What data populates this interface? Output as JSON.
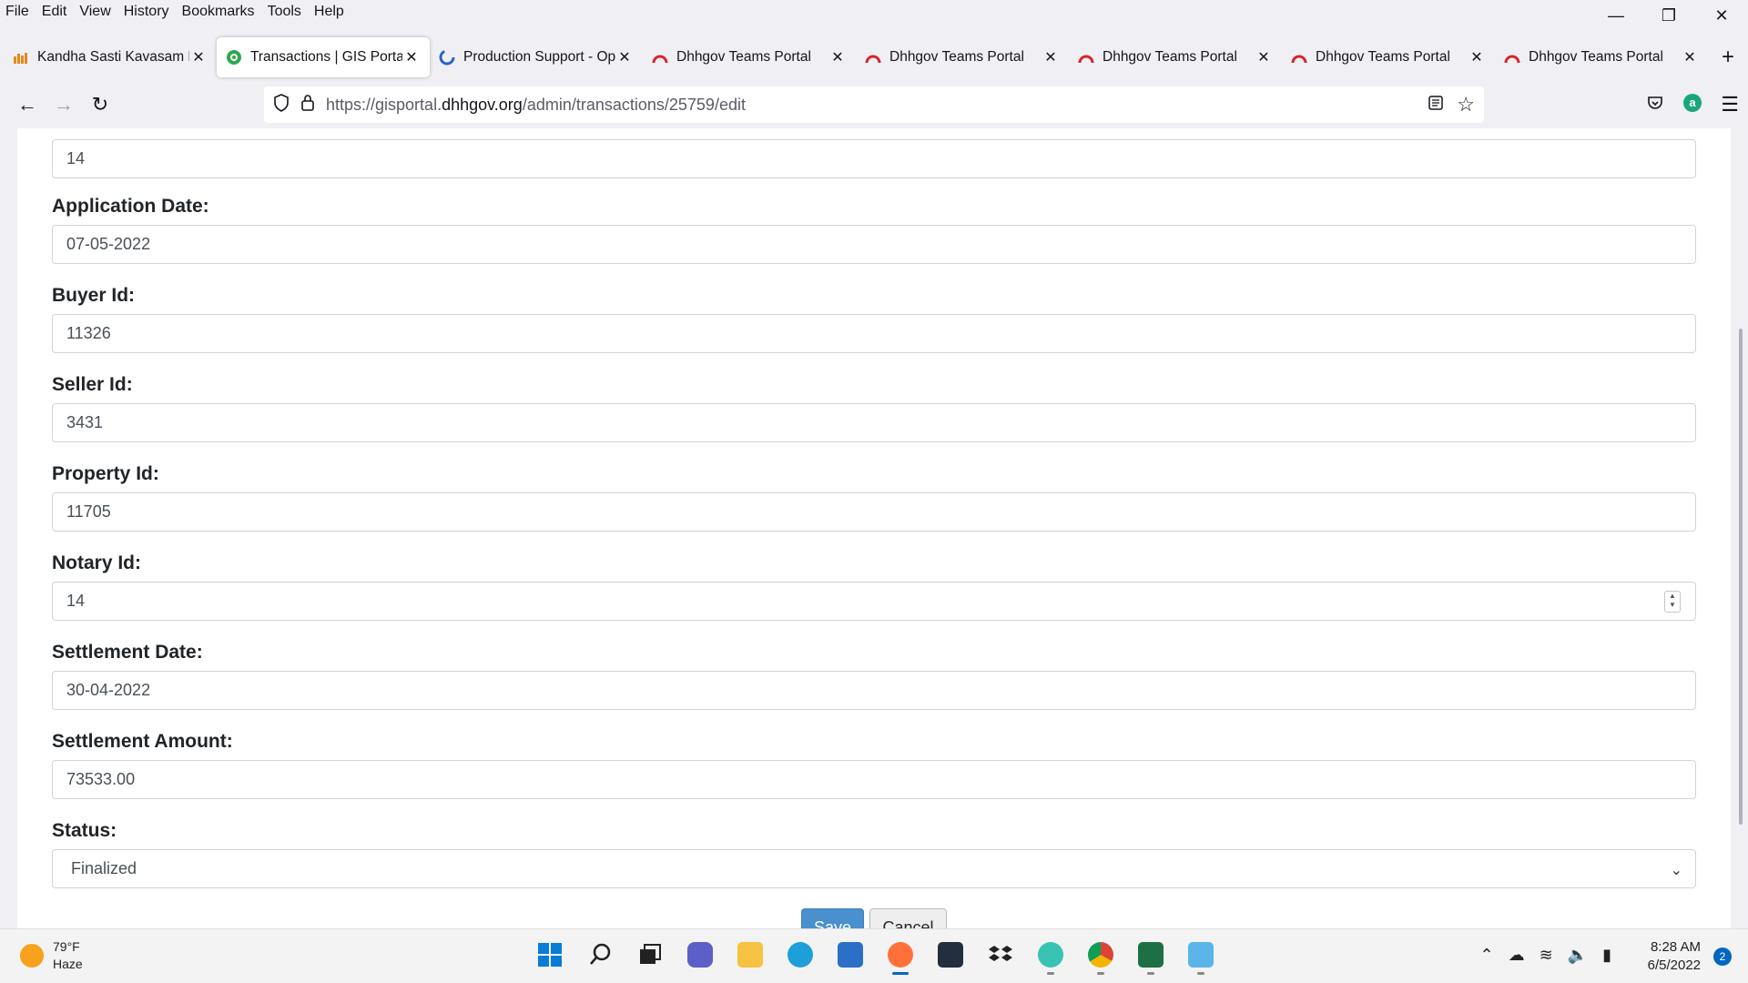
{
  "menubar": {
    "items": [
      "File",
      "Edit",
      "View",
      "History",
      "Bookmarks",
      "Tools",
      "Help"
    ]
  },
  "tabs": [
    {
      "title": "Kandha Sasti Kavasam Ly",
      "icon": "music-icon",
      "active": false
    },
    {
      "title": "Transactions | GIS Portal",
      "icon": "globe-icon",
      "active": true
    },
    {
      "title": "Production Support - Op",
      "icon": "loading-icon",
      "active": false
    },
    {
      "title": "Dhhgov Teams Portal",
      "icon": "teams-logo-icon",
      "active": false
    },
    {
      "title": "Dhhgov Teams Portal",
      "icon": "teams-logo-icon",
      "active": false
    },
    {
      "title": "Dhhgov Teams Portal",
      "icon": "teams-logo-icon",
      "active": false
    },
    {
      "title": "Dhhgov Teams Portal",
      "icon": "teams-logo-icon",
      "active": false
    },
    {
      "title": "Dhhgov Teams Portal",
      "icon": "teams-logo-icon",
      "active": false
    }
  ],
  "urlbar": {
    "prefix": "https://gisportal.",
    "domain": "dhhgov.org",
    "path": "/admin/transactions/25759/edit"
  },
  "form": {
    "top_field_value": "14",
    "application_date": {
      "label": "Application Date:",
      "value": "07-05-2022"
    },
    "buyer_id": {
      "label": "Buyer Id:",
      "value": "11326"
    },
    "seller_id": {
      "label": "Seller Id:",
      "value": "3431"
    },
    "property_id": {
      "label": "Property Id:",
      "value": "11705"
    },
    "notary_id": {
      "label": "Notary Id:",
      "value": "14"
    },
    "settlement_date": {
      "label": "Settlement Date:",
      "value": "30-04-2022"
    },
    "settlement_amount": {
      "label": "Settlement Amount:",
      "value": "73533.00"
    },
    "status": {
      "label": "Status:",
      "value": "Finalized"
    },
    "save_label": "Save",
    "cancel_label": "Cancel"
  },
  "taskbar": {
    "weather_temp": "79°F",
    "weather_desc": "Haze",
    "time": "8:28 AM",
    "date": "6/5/2022",
    "notification_count": "2"
  },
  "colors": {
    "accent": "#0067c0",
    "save_button": "#4a8fce",
    "teams_icon": "#d6262b"
  }
}
